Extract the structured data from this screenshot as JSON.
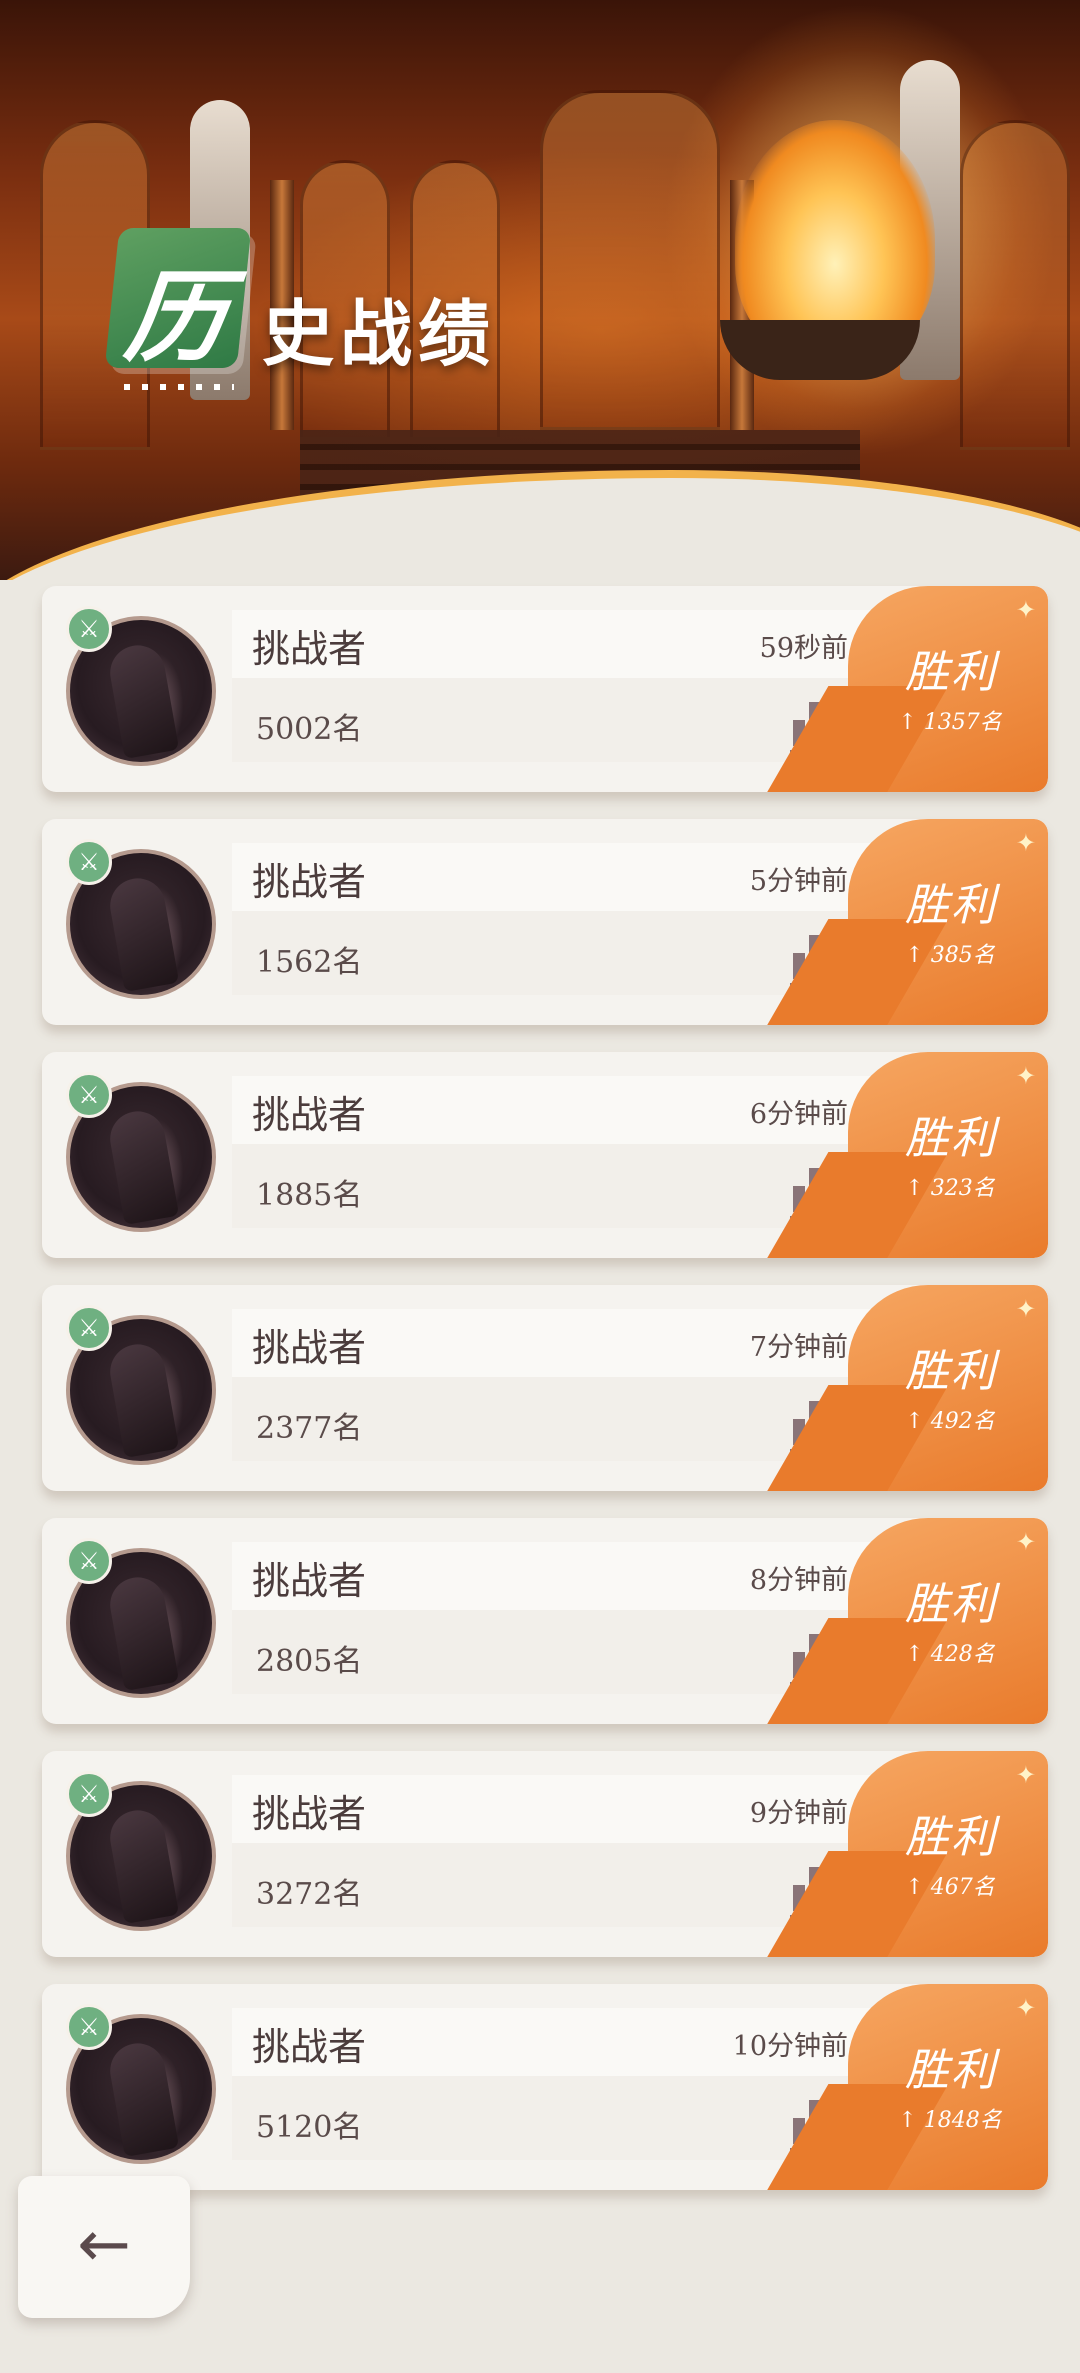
{
  "header": {
    "badge_char": "历",
    "title_rest": "史战绩"
  },
  "icons": {
    "sword": "sword-icon",
    "stats": "bar-chart-icon",
    "back": "back-arrow-icon"
  },
  "colors": {
    "victory_orange": "#e97b2c",
    "badge_green": "#6fb081",
    "title_green": "#2f7a45"
  },
  "records": [
    {
      "name": "挑战者",
      "rank": "5002名",
      "time": "59秒前",
      "result": "胜利",
      "delta": "↑ 1357名"
    },
    {
      "name": "挑战者",
      "rank": "1562名",
      "time": "5分钟前",
      "result": "胜利",
      "delta": "↑ 385名"
    },
    {
      "name": "挑战者",
      "rank": "1885名",
      "time": "6分钟前",
      "result": "胜利",
      "delta": "↑ 323名"
    },
    {
      "name": "挑战者",
      "rank": "2377名",
      "time": "7分钟前",
      "result": "胜利",
      "delta": "↑ 492名"
    },
    {
      "name": "挑战者",
      "rank": "2805名",
      "time": "8分钟前",
      "result": "胜利",
      "delta": "↑ 428名"
    },
    {
      "name": "挑战者",
      "rank": "3272名",
      "time": "9分钟前",
      "result": "胜利",
      "delta": "↑ 467名"
    },
    {
      "name": "挑战者",
      "rank": "5120名",
      "time": "10分钟前",
      "result": "胜利",
      "delta": "↑ 1848名"
    }
  ],
  "back_button": {
    "glyph": "←"
  }
}
